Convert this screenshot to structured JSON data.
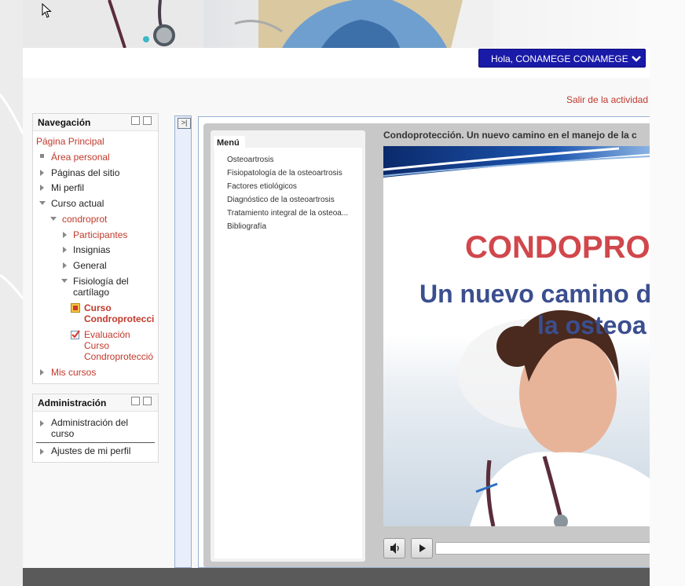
{
  "header": {
    "user_menu_label": "Hola, CONAMEGE CONAMEGE"
  },
  "activity": {
    "exit_link": "Salir de la actividad"
  },
  "navigation_block": {
    "title": "Navegación",
    "home": "Página Principal",
    "items": {
      "area_personal": "Área personal",
      "paginas_sitio": "Páginas del sitio",
      "mi_perfil": "Mi perfil",
      "curso_actual": "Curso actual",
      "condroprot": "condroprot",
      "participantes": "Participantes",
      "insignias": "Insignias",
      "general": "General",
      "fisiologia_l1": "Fisiología del",
      "fisiologia_l2": "cartílago",
      "curso_l1": "Curso",
      "curso_l2": "Condroprotecci",
      "evaluacion_l1": "Evaluación",
      "evaluacion_l2": "Curso",
      "evaluacion_l3": "Condroprotecció",
      "mis_cursos": "Mis cursos"
    }
  },
  "admin_block": {
    "title": "Administración",
    "admin_curso_l1": "Administración del",
    "admin_curso_l2": "curso",
    "ajustes_perfil": "Ajustes de mi perfil"
  },
  "player": {
    "menu_tab": "Menú",
    "menu_items": [
      "Osteoartrosis",
      "Fisiopatología de la osteoartrosis",
      "Factores etiológicos",
      "Diagnóstico de la osteoartrosis",
      "Tratamiento integral de la osteoa...",
      "Bibliografía"
    ],
    "slide_title": "Condoprotección. Un nuevo camino en el manejo de la c",
    "slide_heading": "CONDOPRO",
    "slide_subheading_l1": "Un nuevo camino d",
    "slide_subheading_l2": "la osteoa"
  },
  "colors": {
    "link_red": "#c0392b",
    "user_button_blue": "#1a1aa8",
    "slide_red": "#d0474c",
    "slide_blue": "#3b4f8f"
  },
  "icons": {
    "user_menu_chevron": "chevron-down-icon",
    "dock_toggle": "dock-expand-icon",
    "volume": "speaker-icon",
    "play": "play-icon"
  }
}
